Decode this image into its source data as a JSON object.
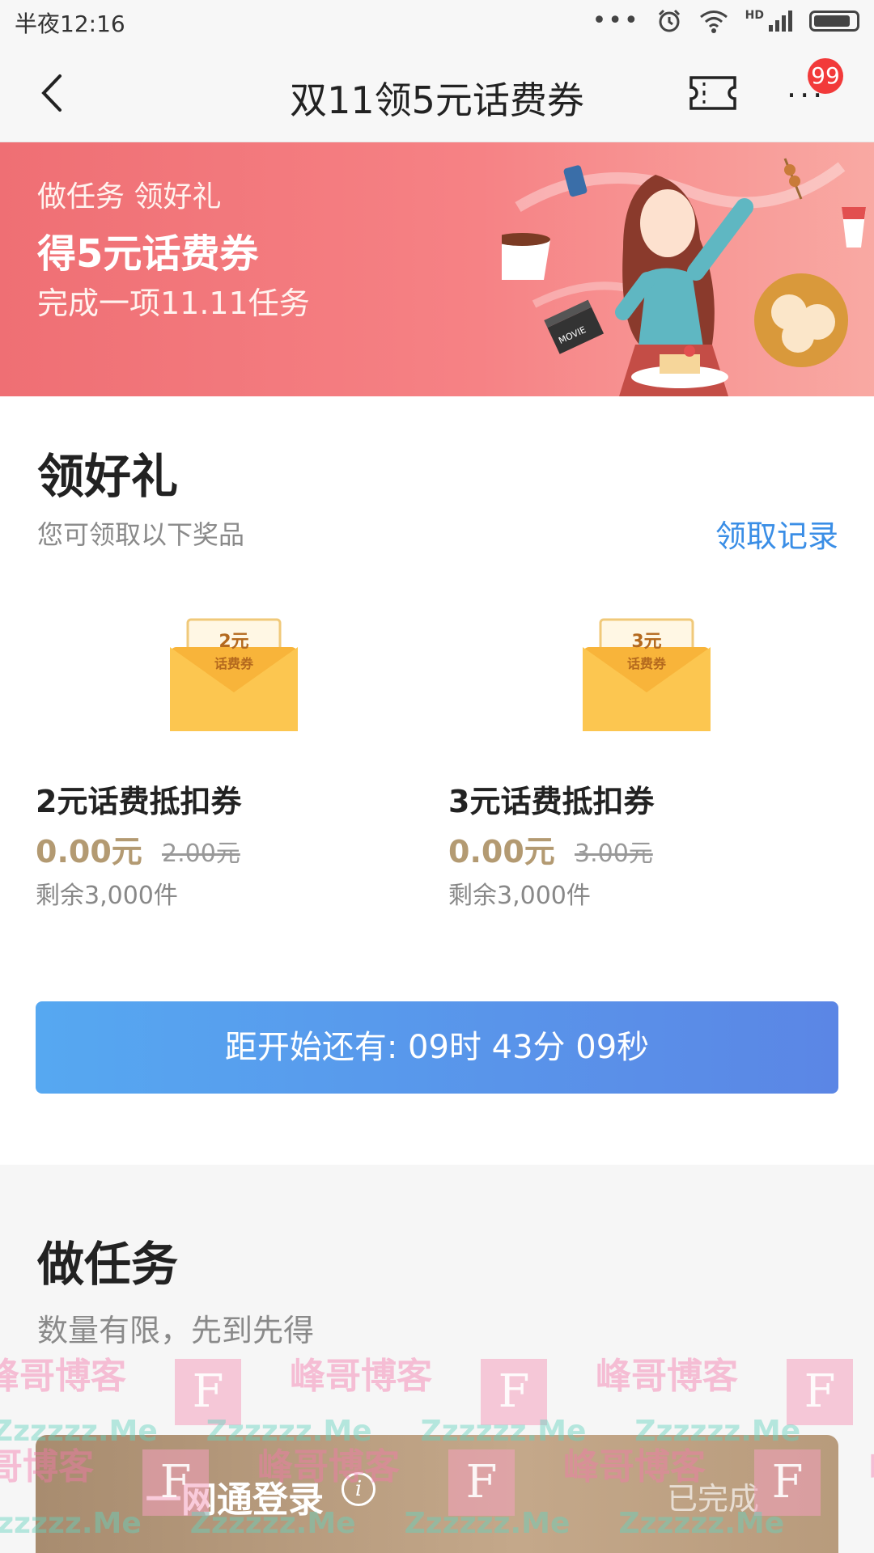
{
  "status_bar": {
    "time": "半夜12:16",
    "dots": "•••",
    "network": "HD"
  },
  "nav": {
    "title": "双11领5元话费券",
    "badge": "99",
    "more": "···"
  },
  "banner": {
    "line1": "做任务 领好礼",
    "line2": "得5元话费券",
    "line3": "完成一项11.11任务",
    "art_label": "MOVIE"
  },
  "gifts": {
    "title": "领好礼",
    "subtitle": "您可领取以下奖品",
    "records_link": "领取记录",
    "items": [
      {
        "envelope_amount": "2元",
        "envelope_label": "话费券",
        "name": "2元话费抵扣券",
        "price": "0.00元",
        "original_price": "2.00元",
        "stock": "剩余3,000件"
      },
      {
        "envelope_amount": "3元",
        "envelope_label": "话费券",
        "name": "3元话费抵扣券",
        "price": "0.00元",
        "original_price": "3.00元",
        "stock": "剩余3,000件"
      }
    ],
    "countdown": "距开始还有: 09时 43分 09秒"
  },
  "tasks": {
    "title": "做任务",
    "subtitle": "数量有限，先到先得",
    "items": [
      {
        "label": "一网通登录",
        "info": "i",
        "status": "已完成"
      }
    ]
  },
  "watermark": {
    "site": "峰哥博客",
    "url": "Zzzzzz.Me",
    "logo": "F"
  },
  "colors": {
    "banner": "#ef6f74",
    "countdown": "#5b86e5",
    "link": "#3a8ee6",
    "price": "#b39a72",
    "badge": "#f23a3a",
    "task_card": "#b89b7c"
  }
}
